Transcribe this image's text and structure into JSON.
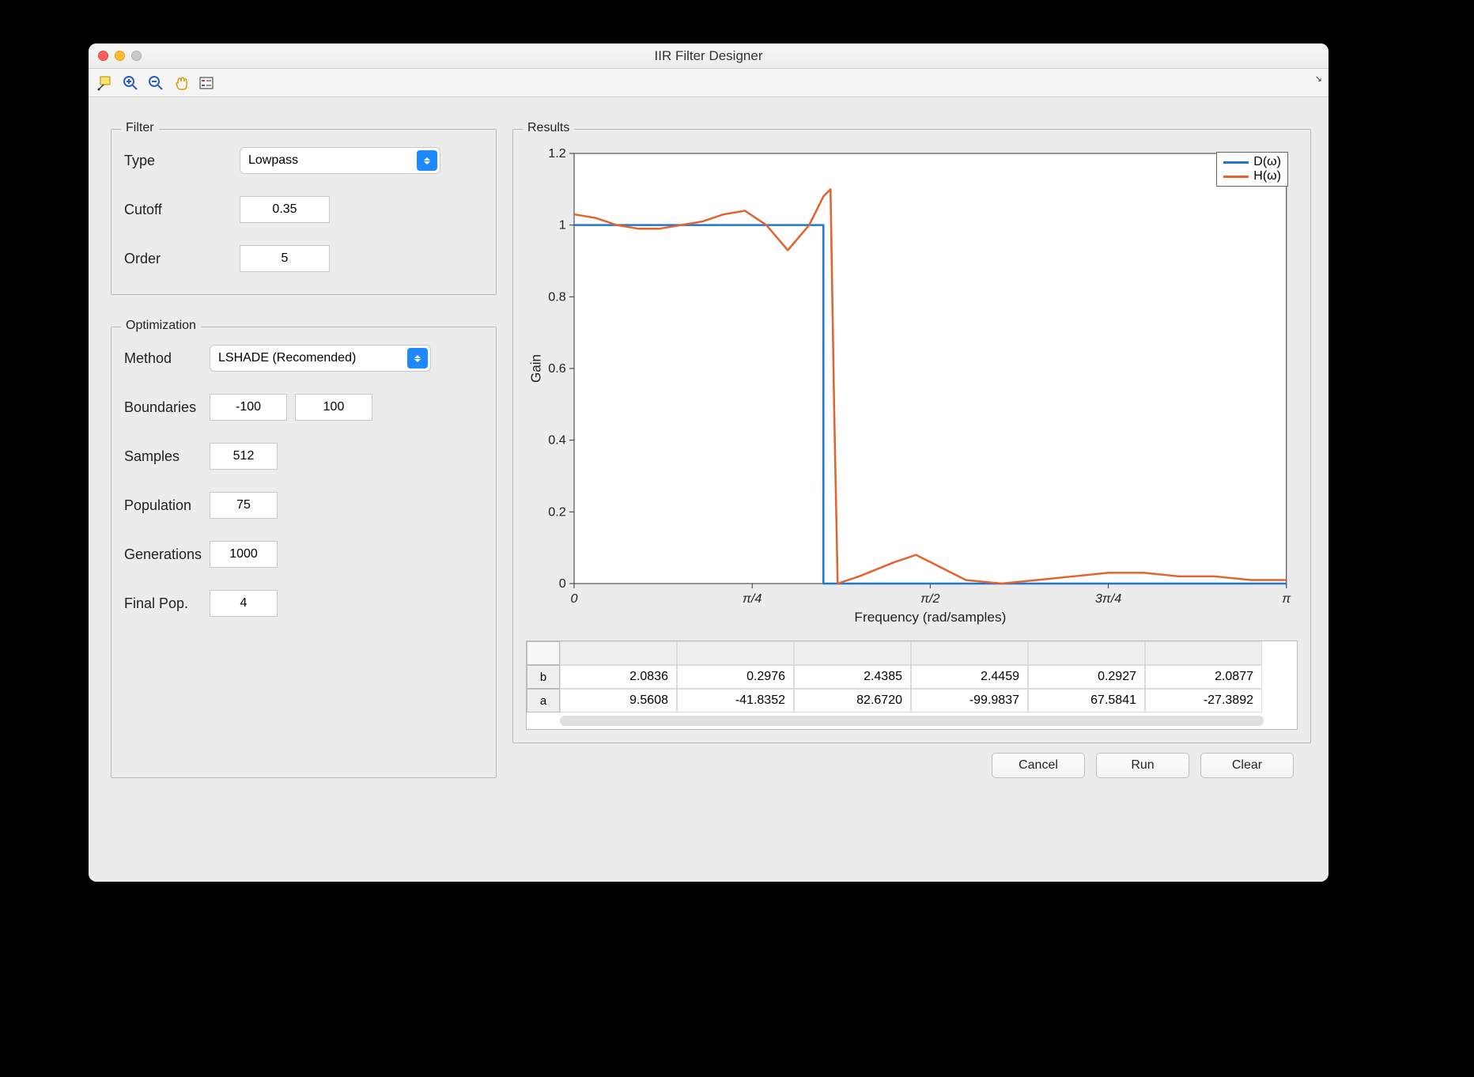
{
  "window": {
    "title": "IIR Filter Designer"
  },
  "filter": {
    "group_title": "Filter",
    "type_label": "Type",
    "type_value": "Lowpass",
    "cutoff_label": "Cutoff",
    "cutoff_value": "0.35",
    "order_label": "Order",
    "order_value": "5"
  },
  "optimization": {
    "group_title": "Optimization",
    "method_label": "Method",
    "method_value": "LSHADE (Recomended)",
    "boundaries_label": "Boundaries",
    "boundaries_lo": "-100",
    "boundaries_hi": "100",
    "samples_label": "Samples",
    "samples_value": "512",
    "population_label": "Population",
    "population_value": "75",
    "generations_label": "Generations",
    "generations_value": "1000",
    "finalpop_label": "Final Pop.",
    "finalpop_value": "4"
  },
  "results": {
    "group_title": "Results",
    "legend_d": "D(ω)",
    "legend_h": "H(ω)",
    "ylabel": "Gain",
    "xlabel": "Frequency (rad/samples)",
    "row_b_label": "b",
    "row_a_label": "a",
    "b": [
      "2.0836",
      "0.2976",
      "2.4385",
      "2.4459",
      "0.2927",
      "2.0877"
    ],
    "a": [
      "9.5608",
      "-41.8352",
      "82.6720",
      "-99.9837",
      "67.5841",
      "-27.3892"
    ]
  },
  "buttons": {
    "cancel": "Cancel",
    "run": "Run",
    "clear": "Clear"
  },
  "chart_data": {
    "type": "line",
    "title": "",
    "xlabel": "Frequency (rad/samples)",
    "ylabel": "Gain",
    "ylim": [
      0,
      1.2
    ],
    "xlim": [
      0,
      1
    ],
    "xticks_labels": [
      "0",
      "π/4",
      "π/2",
      "3π/4",
      "π"
    ],
    "yticks": [
      0,
      0.2,
      0.4,
      0.6,
      0.8,
      1,
      1.2
    ],
    "series": [
      {
        "name": "D(ω)",
        "color": "#1f77d4",
        "x": [
          0,
          0.35,
          0.35,
          1.0
        ],
        "y": [
          1.0,
          1.0,
          0.0,
          0.0
        ]
      },
      {
        "name": "H(ω)",
        "color": "#e1632e",
        "x": [
          0.0,
          0.03,
          0.06,
          0.09,
          0.12,
          0.15,
          0.18,
          0.21,
          0.24,
          0.27,
          0.3,
          0.33,
          0.35,
          0.36,
          0.365,
          0.37,
          0.4,
          0.45,
          0.48,
          0.5,
          0.55,
          0.6,
          0.65,
          0.7,
          0.75,
          0.8,
          0.85,
          0.9,
          0.95,
          1.0
        ],
        "y": [
          1.03,
          1.02,
          1.0,
          0.99,
          0.99,
          1.0,
          1.01,
          1.03,
          1.04,
          1.0,
          0.93,
          1.0,
          1.08,
          1.1,
          0.5,
          0.0,
          0.02,
          0.06,
          0.08,
          0.06,
          0.01,
          0.0,
          0.01,
          0.02,
          0.03,
          0.03,
          0.02,
          0.02,
          0.01,
          0.01
        ]
      }
    ]
  }
}
